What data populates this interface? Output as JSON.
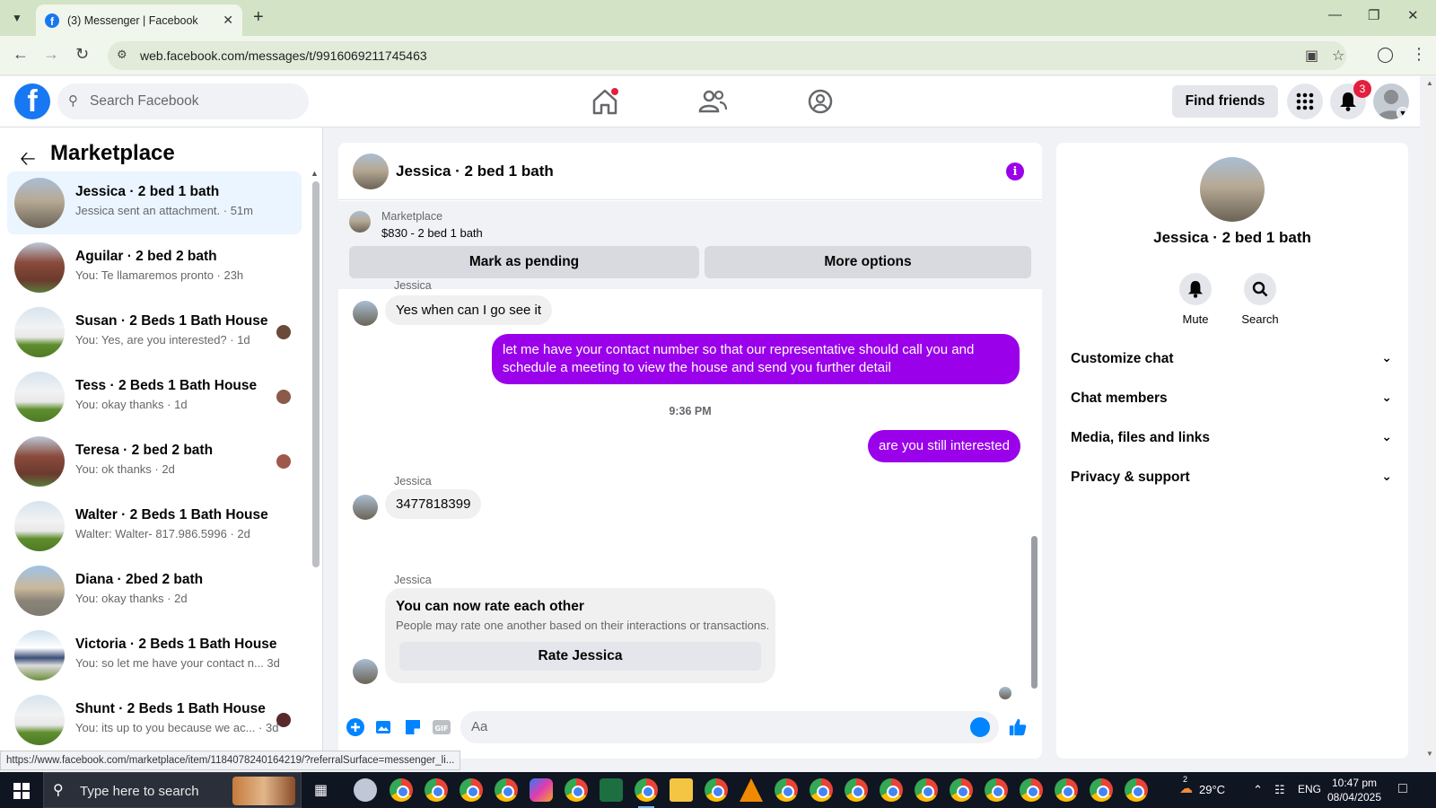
{
  "browser": {
    "tab_title": "(3) Messenger | Facebook",
    "url": "web.facebook.com/messages/t/9916069211745463",
    "status_url": "https://www.facebook.com/marketplace/item/1184078240164219/?referralSurface=messenger_li..."
  },
  "fb": {
    "logo": "f",
    "search_placeholder": "Search Facebook",
    "find_friends": "Find friends",
    "notif_count": "3"
  },
  "sidebar": {
    "title": "Marketplace",
    "conversations": [
      {
        "name": "Jessica · 2 bed 1 bath",
        "snippet": "Jessica sent an attachment. · 51m"
      },
      {
        "name": "Aguilar · 2 bed 2 bath",
        "snippet": "You: Te llamaremos pronto · 23h"
      },
      {
        "name": "Susan · 2 Beds 1 Bath House",
        "snippet": "You: Yes, are you interested? · 1d"
      },
      {
        "name": "Tess · 2 Beds 1 Bath House",
        "snippet": "You: okay thanks · 1d"
      },
      {
        "name": "Teresa · 2 bed 2 bath",
        "snippet": "You: ok thanks · 2d"
      },
      {
        "name": "Walter · 2 Beds 1 Bath House",
        "snippet": "Walter: Walter- 817.986.5996 · 2d"
      },
      {
        "name": "Diana · 2bed 2 bath",
        "snippet": "You: okay thanks · 2d"
      },
      {
        "name": "Victoria · 2 Beds 1 Bath House",
        "snippet": "You: so let me have your contact n...  3d"
      },
      {
        "name": "Shunt · 2 Beds 1 Bath House",
        "snippet": "You: its up to you because we ac... · 3d"
      }
    ]
  },
  "chat": {
    "title": "Jessica · 2 bed 1 bath",
    "marketplace_label": "Marketplace",
    "listing": "$830 - 2 bed 1 bath",
    "mark_pending": "Mark as pending",
    "more_options": "More options",
    "sender_partial": "Jessica",
    "msg1": "Yes when can I go see it",
    "out1": "let me have your contact number so that our representative should call you and schedule a meeting to view the house and send you further detail",
    "time": "9:36 PM",
    "out2": "are you still interested",
    "sender2": "Jessica",
    "msg2": "3477818399",
    "sender3": "Jessica",
    "rate_title": "You can now rate each other",
    "rate_sub": "People may rate one another based on their interactions or transactions.",
    "rate_button": "Rate Jessica",
    "composer_placeholder": "Aa"
  },
  "right_panel": {
    "name": "Jessica · 2 bed 1 bath",
    "mute": "Mute",
    "search": "Search",
    "rows": [
      "Customize chat",
      "Chat members",
      "Media, files and links",
      "Privacy & support"
    ]
  },
  "taskbar": {
    "search_placeholder": "Type here to search",
    "temp": "29°C",
    "lang": "ENG",
    "time": "10:47 pm",
    "date": "08/04/2025",
    "weather_badge": "2"
  },
  "colors": {
    "fb_blue": "#1877f2",
    "outgoing_bubble": "#9a00ea",
    "active_conv": "#ebf5ff"
  }
}
